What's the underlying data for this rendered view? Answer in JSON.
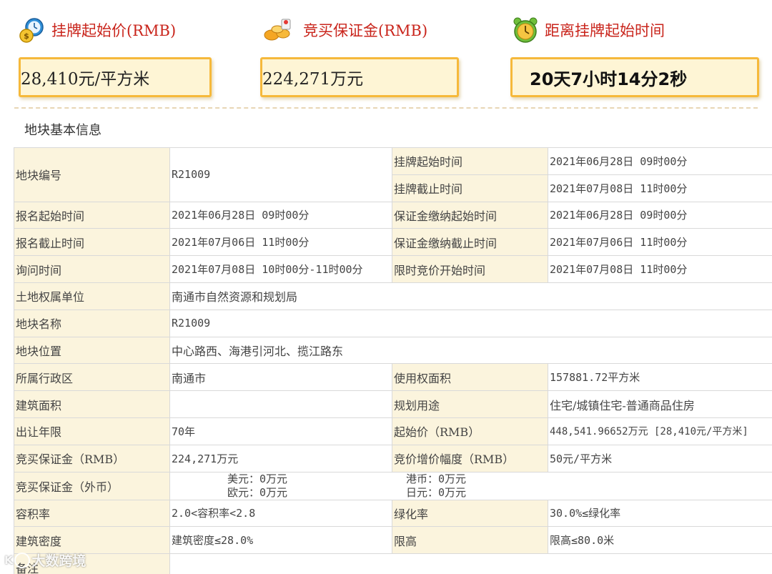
{
  "header": {
    "start_price_label": "挂牌起始价(RMB)",
    "deposit_label": "竞买保证金(RMB)",
    "countdown_label": "距离挂牌起始时间",
    "start_price_value": "28,410元/平方米",
    "deposit_value": "224,271万元",
    "countdown_value": "20天7小时14分2秒"
  },
  "section": {
    "title": "地块基本信息"
  },
  "rows": {
    "r1": {
      "k1": "地块编号",
      "v1": "R21009",
      "k2a": "挂牌起始时间",
      "v2a": "2021年06月28日 09时00分",
      "k2b": "挂牌截止时间",
      "v2b": "2021年07月08日 11时00分"
    },
    "r2": {
      "k1": "报名起始时间",
      "v1": "2021年06月28日 09时00分",
      "k2": "保证金缴纳起始时间",
      "v2": "2021年06月28日 09时00分"
    },
    "r3": {
      "k1": "报名截止时间",
      "v1": "2021年07月06日 11时00分",
      "k2": "保证金缴纳截止时间",
      "v2": "2021年07月06日 11时00分"
    },
    "r4": {
      "k1": "询问时间",
      "v1": "2021年07月08日 10时00分-11时00分",
      "k2": "限时竞价开始时间",
      "v2": "2021年07月08日 11时00分"
    },
    "r5": {
      "k1": "土地权属单位",
      "v1": "南通市自然资源和规划局"
    },
    "r6": {
      "k1": "地块名称",
      "v1": "R21009"
    },
    "r7": {
      "k1": "地块位置",
      "v1": "中心路西、海港引河北、揽江路东"
    },
    "r8": {
      "k1": "所属行政区",
      "v1": "南通市",
      "k2": "使用权面积",
      "v2": "157881.72平方米"
    },
    "r9": {
      "k1": "建筑面积",
      "v1": "",
      "k2": "规划用途",
      "v2": "住宅/城镇住宅-普通商品住房"
    },
    "r10": {
      "k1": "出让年限",
      "v1": "70年",
      "k2": "起始价（RMB）",
      "v2": "448,541.96652万元 [28,410元/平方米]"
    },
    "r11": {
      "k1": "竞买保证金（RMB）",
      "v1": "224,271万元",
      "k2": "竞价增价幅度（RMB）",
      "v2": "50元/平方米"
    },
    "r12": {
      "k1": "竞买保证金（外币）",
      "usd": "美元：0万元",
      "hkd": "港币：0万元",
      "eur": "欧元：0万元",
      "jpy": "日元：0万元"
    },
    "r13": {
      "k1": "容积率",
      "v1": "2.0<容积率<2.8",
      "k2": "绿化率",
      "v2": "30.0%≤绿化率"
    },
    "r14": {
      "k1": "建筑密度",
      "v1": "建筑密度≤28.0%",
      "k2": "限高",
      "v2": "限高≤80.0米"
    },
    "r15": {
      "k1": "备注",
      "v1": ""
    }
  },
  "watermark": {
    "text": "大数跨境"
  },
  "icons": {
    "price": "money-clock-icon",
    "deposit": "coins-icon",
    "countdown": "alarm-clock-icon"
  },
  "colors": {
    "accent_red": "#c9251c",
    "box_border": "#f6b93b",
    "box_fill": "#fef5d5",
    "key_cell": "#fbf4dd"
  }
}
